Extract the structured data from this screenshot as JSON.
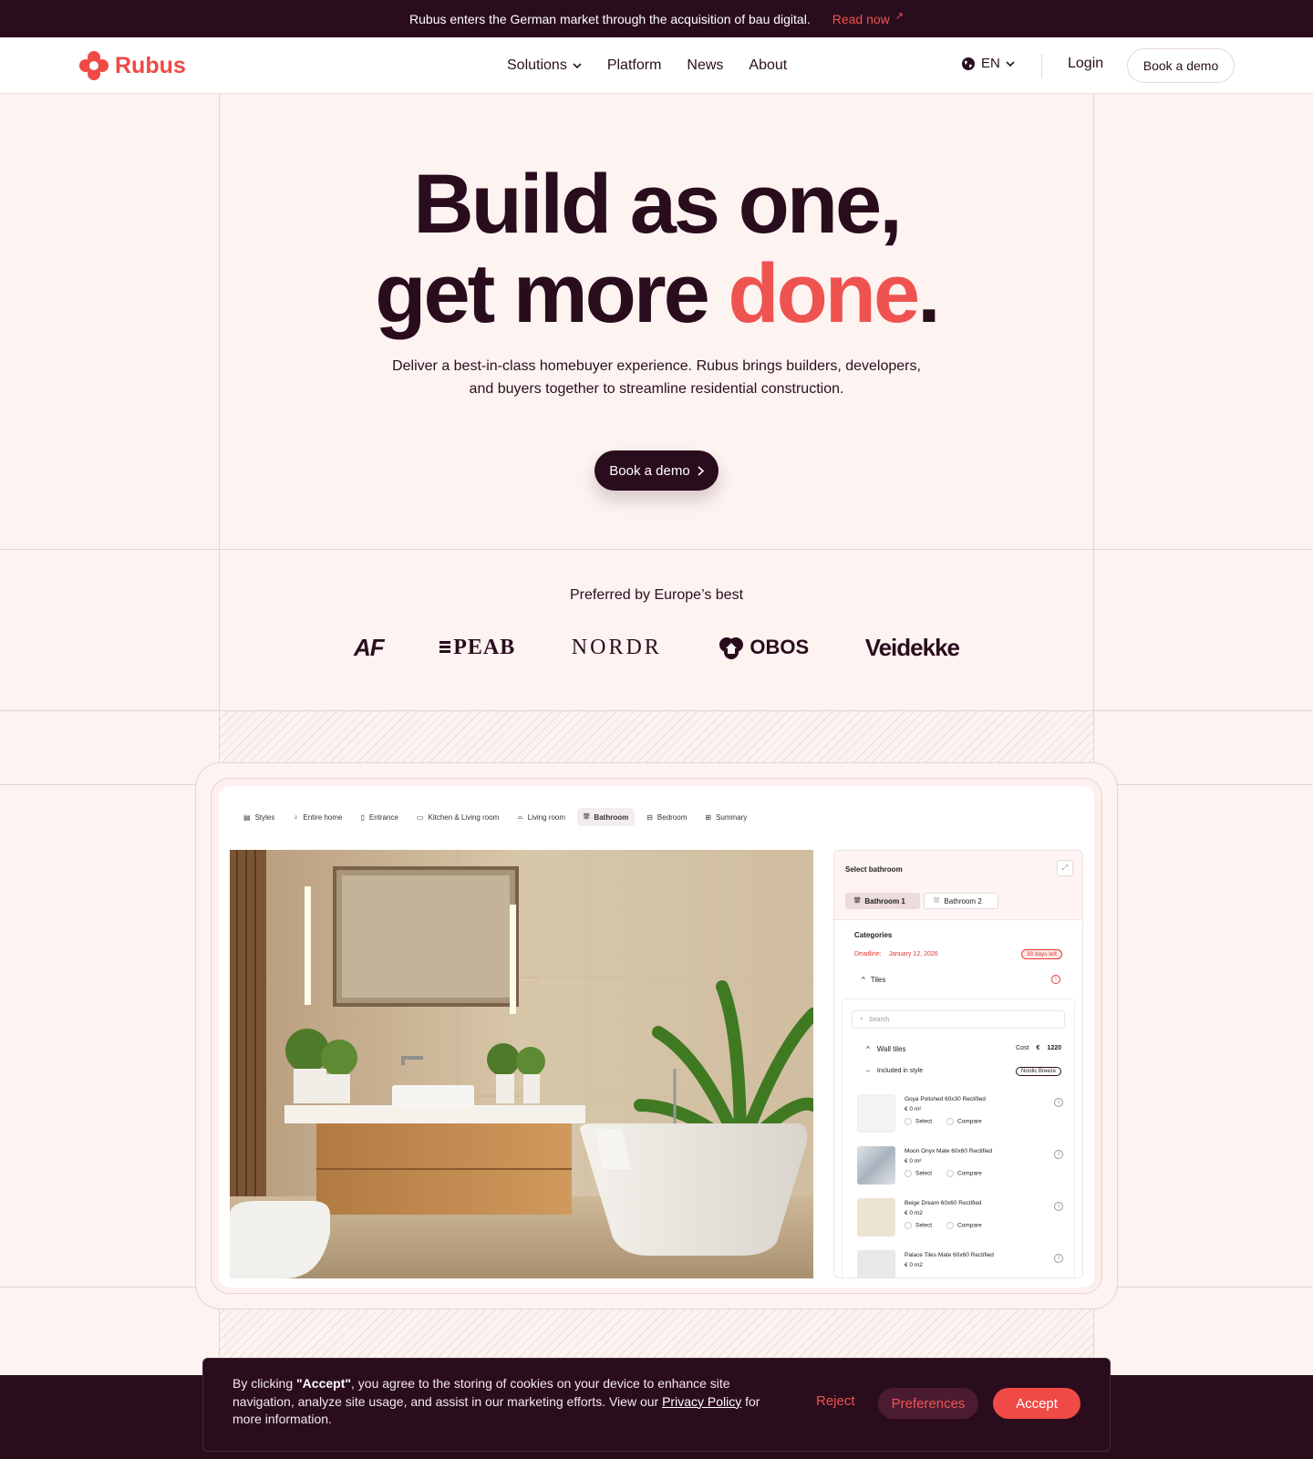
{
  "announcement": {
    "text": "Rubus enters the German market through the acquisition of bau digital.",
    "link": "Read now",
    "link_icon": "arrow-up-right-icon"
  },
  "nav": {
    "logo_text": "Rubus",
    "items": [
      "Solutions",
      "Platform",
      "News",
      "About"
    ],
    "language": "EN",
    "login": "Login",
    "demo": "Book a demo"
  },
  "hero": {
    "line1": "Build as one,",
    "line2_start": "get more ",
    "line2_accent": "done",
    "line2_end": ".",
    "subtitle": "Deliver a best-in-class homebuyer experience. Rubus brings builders, developers, and buyers together to streamline residential construction.",
    "cta": "Book a demo"
  },
  "partners": {
    "heading": "Preferred by Europe’s best",
    "logos": [
      "AF",
      "PEAB",
      "NORDR",
      "OBOS",
      "Veidekke"
    ]
  },
  "app": {
    "tabs": [
      "Styles",
      "Entire home",
      "Entrance",
      "Kitchen & Living room",
      "Living room",
      "Bathroom",
      "Bedroom",
      "Summary"
    ],
    "active_tab": "Bathroom",
    "panel": {
      "title": "Select bathroom",
      "bathrooms": [
        "Bathroom 1",
        "Bathroom 2"
      ],
      "categories": "Categories",
      "deadline_label": "Deadline:",
      "deadline_date": "January 12, 2026",
      "days_left": "38 days left",
      "tiles": "Tiles",
      "search_placeholder": "Search",
      "wall_tiles": "Wall tiles",
      "cost_label": "Cost",
      "currency": "€",
      "cost_value": "1220",
      "included": "Included in style",
      "style_badge": "Nordic Breeze",
      "select": "Select",
      "compare": "Compare",
      "products": [
        {
          "name": "Goya Polished 60x30 Rectified",
          "price": "€  0 m²",
          "swatch": "#f3f3f3"
        },
        {
          "name": "Moon Onyx Mate 60x60 Rectified",
          "price": "€  0 m²",
          "swatch": "#c7ced6"
        },
        {
          "name": "Beige Dream 60x60 Rectified",
          "price": "€  0 m2",
          "swatch": "#ede3d3"
        },
        {
          "name": "Palace Tiles Mate 60x60 Rectified",
          "price": "€  0 m2",
          "swatch": "#e8e8e6"
        }
      ]
    }
  },
  "cookie": {
    "prefix": "By clicking ",
    "accept_quote": "\"Accept\"",
    "middle": ", you agree to the storing of cookies on your device to enhance site navigation, analyze site usage, and assist in our marketing efforts. View our ",
    "policy_link": "Privacy Policy",
    "suffix": " for more information.",
    "reject": "Reject",
    "preferences": "Preferences",
    "accept": "Accept"
  },
  "colors": {
    "brand_red": "#ef4a46",
    "dark_plum": "#2a0d1d",
    "background": "#fdf3f1"
  }
}
